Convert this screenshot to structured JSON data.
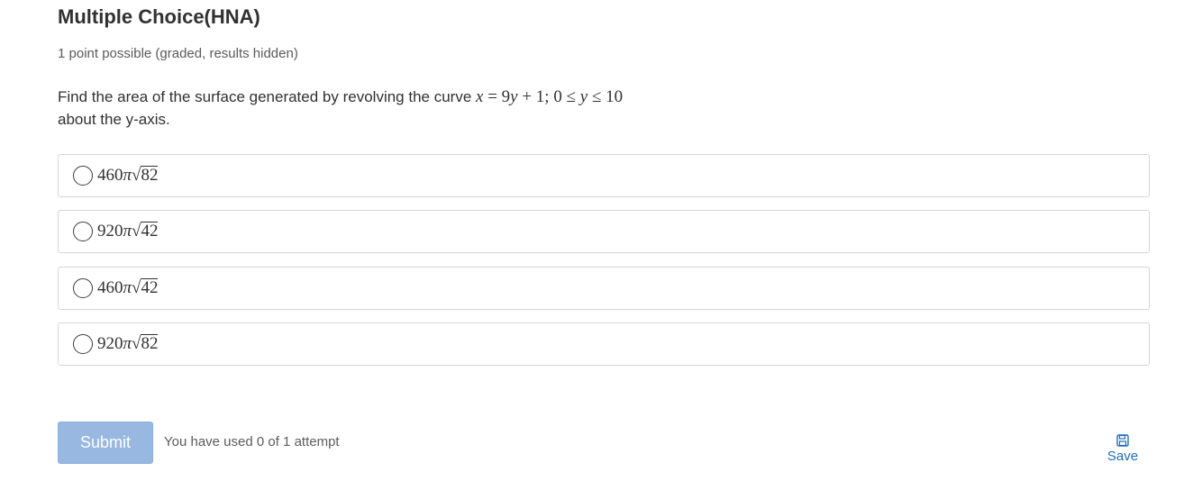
{
  "problem": {
    "title": "Multiple Choice(HNA)",
    "points": "1 point possible (graded, results hidden)",
    "question_prefix": "Find the area of the surface generated by revolving the curve ",
    "question_math": {
      "var_x": "x",
      "eq": " = 9",
      "var_y1": "y",
      "mid": " + 1; 0 ≤ ",
      "var_y2": "y",
      "tail": " ≤ 10"
    },
    "question_suffix": "about the y-axis."
  },
  "choices": [
    {
      "coef": "460",
      "pi": "π",
      "radicand": "82"
    },
    {
      "coef": "920",
      "pi": "π",
      "radicand": "42"
    },
    {
      "coef": "460",
      "pi": "π",
      "radicand": "42"
    },
    {
      "coef": "920",
      "pi": "π",
      "radicand": "82"
    }
  ],
  "actions": {
    "submit_label": "Submit",
    "attempts_text": "You have used 0 of 1 attempt",
    "save_label": "Save",
    "save_icon": "floppy-disk-icon"
  },
  "colors": {
    "submit_bg": "#98b8e1",
    "link": "#1e6fb8",
    "border": "#d6d6d6"
  }
}
